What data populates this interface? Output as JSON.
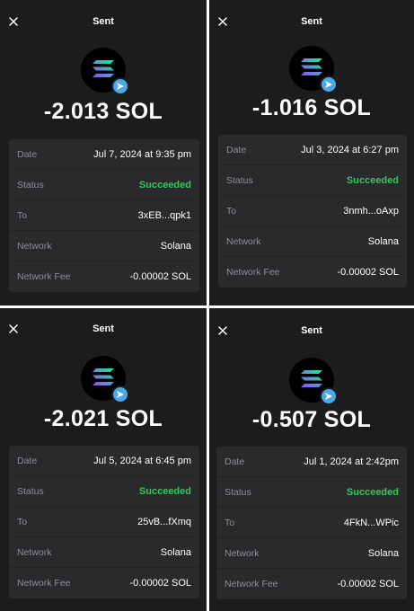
{
  "colors": {
    "background": "#1c1c1e",
    "card": "#2a2a2d",
    "label": "#8e8e93",
    "success": "#34c759",
    "badge": "#4aa8e8"
  },
  "icons": {
    "close": "close-icon",
    "token": "solana-logo",
    "badge": "send-arrow-icon"
  },
  "panels": [
    {
      "title": "Sent",
      "amount": "-2.013 SOL",
      "rows": [
        {
          "label": "Date",
          "value": "Jul 7, 2024 at 9:35 pm"
        },
        {
          "label": "Status",
          "value": "Succeeded"
        },
        {
          "label": "To",
          "value": "3xEB...qpk1"
        },
        {
          "label": "Network",
          "value": "Solana"
        },
        {
          "label": "Network Fee",
          "value": "-0.00002 SOL"
        }
      ]
    },
    {
      "title": "Sent",
      "amount": "-1.016 SOL",
      "rows": [
        {
          "label": "Date",
          "value": "Jul 3, 2024 at 6:27 pm"
        },
        {
          "label": "Status",
          "value": "Succeeded"
        },
        {
          "label": "To",
          "value": "3nmh...oAxp"
        },
        {
          "label": "Network",
          "value": "Solana"
        },
        {
          "label": "Network Fee",
          "value": "-0.00002 SOL"
        }
      ]
    },
    {
      "title": "Sent",
      "amount": "-2.021 SOL",
      "rows": [
        {
          "label": "Date",
          "value": "Jul 5, 2024 at 6:45 pm"
        },
        {
          "label": "Status",
          "value": "Succeeded"
        },
        {
          "label": "To",
          "value": "25vB...fXmq"
        },
        {
          "label": "Network",
          "value": "Solana"
        },
        {
          "label": "Network Fee",
          "value": "-0.00002 SOL"
        }
      ]
    },
    {
      "title": "Sent",
      "amount": "-0.507 SOL",
      "rows": [
        {
          "label": "Date",
          "value": "Jul 1, 2024 at 2:42pm"
        },
        {
          "label": "Status",
          "value": "Succeeded"
        },
        {
          "label": "To",
          "value": "4FkN...WPic"
        },
        {
          "label": "Network",
          "value": "Solana"
        },
        {
          "label": "Network Fee",
          "value": "-0.00002 SOL"
        }
      ]
    }
  ]
}
